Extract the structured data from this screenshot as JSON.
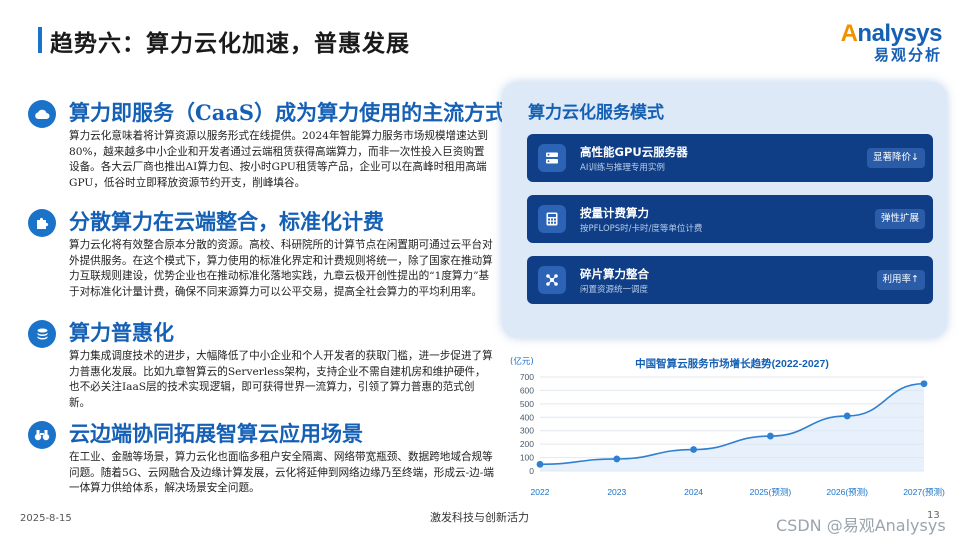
{
  "header": {
    "title": "趋势六：算力云化加速，普惠发展",
    "logo_en_a": "A",
    "logo_en_rest": "nalysys",
    "logo_cn": "易观分析"
  },
  "sections": [
    {
      "icon": "cloud-icon",
      "title": "算力即服务（CaaS）成为算力使用的主流方式",
      "body": "算力云化意味着将计算资源以服务形式在线提供。2024年智能算力服务市场规模增速达到80%，越来越多中小企业和开发者通过云端租赁获得高端算力，而非一次性投入巨资购置设备。各大云厂商也推出AI算力包、按小时GPU租赁等产品，企业可以在高峰时租用高端GPU，低谷时立即释放资源节约开支，削峰填谷。"
    },
    {
      "icon": "puzzle-icon",
      "title": "分散算力在云端整合，标准化计费",
      "body": "算力云化将有效整合原本分散的资源。高校、科研院所的计算节点在闲置期可通过云平台对外提供服务。在这个模式下，算力使用的标准化界定和计费规则将统一，除了国家在推动算力互联规则建设，优势企业也在推动标准化落地实践，九章云极开创性提出的“1度算力”基于对标准化计量计费，确保不同来源算力可以公平交易，提高全社会算力的平均利用率。"
    },
    {
      "icon": "coins-icon",
      "title": "算力普惠化",
      "body": "算力集成调度技术的进步，大幅降低了中小企业和个人开发者的获取门槛，进一步促进了算力普惠化发展。比如九章智算云的Serverless架构，支持企业不需自建机房和维护硬件，也不必关注IaaS层的技术实现逻辑，即可获得世界一流算力，引领了算力普惠的范式创新。"
    },
    {
      "icon": "binoculars-icon",
      "title": "云边端协同拓展智算云应用场景",
      "body": "在工业、金融等场景，算力云化也面临多租户安全隔离、网络带宽瓶颈、数据跨地域合规等问题。随着5G、云网融合及边缘计算发展，云化将延伸到网络边缘乃至终端，形成云-边-端一体算力供给体系，解决场景安全问题。"
    }
  ],
  "panel": {
    "title": "算力云化服务模式",
    "items": [
      {
        "icon": "server-icon",
        "name": "高性能GPU云服务器",
        "sub": "AI训练与推理专用实例",
        "badge": "显著降价↓"
      },
      {
        "icon": "calculator-icon",
        "name": "按量计费算力",
        "sub": "按PFLOPS时/卡时/度等单位计费",
        "badge": "弹性扩展"
      },
      {
        "icon": "network-icon",
        "name": "碎片算力整合",
        "sub": "闲置资源统一调度",
        "badge": "利用率↑"
      }
    ]
  },
  "chart_data": {
    "type": "line",
    "title": "中国智算云服务市场增长趋势(2022-2027)",
    "ylabel": "(亿元)",
    "xlabel": "",
    "categories": [
      "2022",
      "2023",
      "2024",
      "2025(预测)",
      "2026(预测)",
      "2027(预测)"
    ],
    "values": [
      50,
      90,
      160,
      260,
      410,
      650
    ],
    "ylim": [
      0,
      700
    ],
    "yticks": [
      0,
      100,
      200,
      300,
      400,
      500,
      600,
      700
    ],
    "grid": true,
    "colors": {
      "line": "#2f80d1",
      "fill": "#d6e6f7",
      "point": "#2f80d1"
    }
  },
  "footer": {
    "date": "2025-8-15",
    "center": "激发科技与创新活力",
    "page": "13",
    "watermark": "CSDN @易观Analysys"
  }
}
